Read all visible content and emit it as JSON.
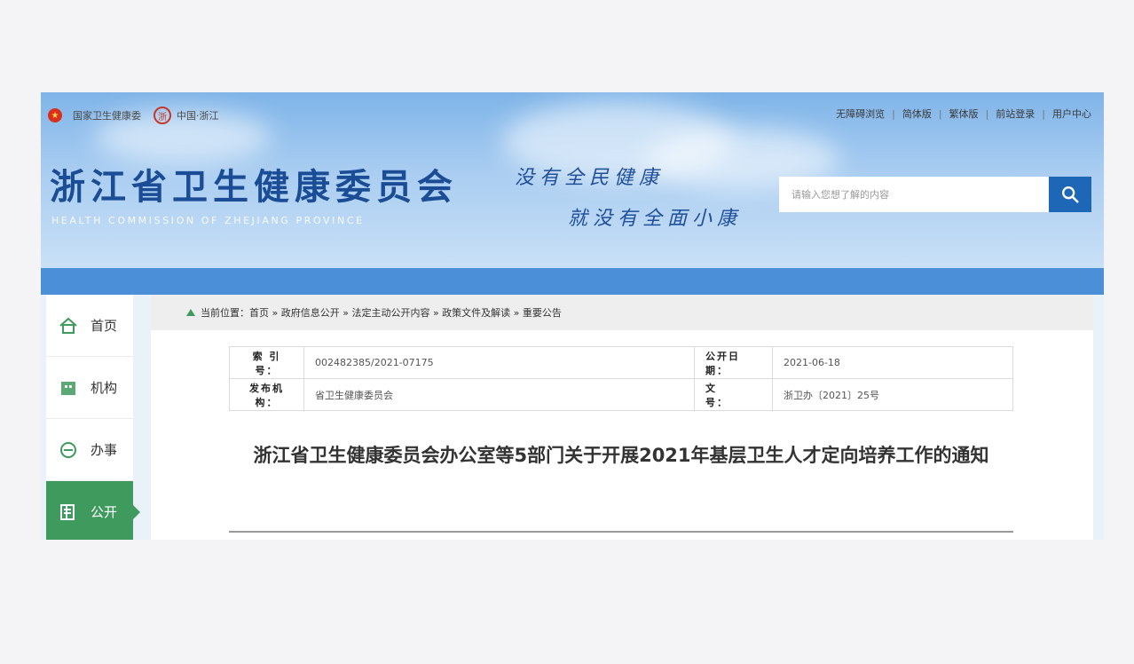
{
  "header": {
    "top_left": {
      "link1": "国家卫生健康委",
      "link2": "中国·浙江"
    },
    "top_right": [
      "无障碍浏览",
      "简体版",
      "繁体版",
      "前站登录",
      "用户中心"
    ],
    "site_title": "浙江省卫生健康委员会",
    "site_subtitle": "HEALTH COMMISSION OF ZHEJIANG PROVINCE",
    "slogan_line1": "没有全民健康",
    "slogan_line2": "就没有全面小康",
    "search": {
      "placeholder": "请输入您想了解的内容"
    }
  },
  "sidebar": {
    "items": [
      {
        "label": "首页",
        "icon": "home-icon"
      },
      {
        "label": "机构",
        "icon": "building-icon"
      },
      {
        "label": "办事",
        "icon": "service-icon"
      },
      {
        "label": "公开",
        "icon": "document-icon",
        "active": true
      }
    ]
  },
  "breadcrumb": {
    "prefix": "当前位置：",
    "path": "首页 » 政府信息公开 » 法定主动公开内容 » 政策文件及解读 » 重要公告"
  },
  "meta": {
    "index_label": "索 引 号：",
    "index_value": "002482385/2021-07175",
    "publish_date_label": "公开日期：",
    "publish_date_value": "2021-06-18",
    "issuer_label": "发布机构：",
    "issuer_value": "省卫生健康委员会",
    "doc_no_label": "文　　号：",
    "doc_no_value": "浙卫办〔2021〕25号"
  },
  "document": {
    "title": "浙江省卫生健康委员会办公室等5部门关于开展2021年基层卫生人才定向培养工作的通知"
  },
  "colors": {
    "header_blue": "#7fb4e8",
    "title_blue": "#1a4d96",
    "accent_green": "#3f9a5e",
    "search_button": "#1e66b6"
  }
}
